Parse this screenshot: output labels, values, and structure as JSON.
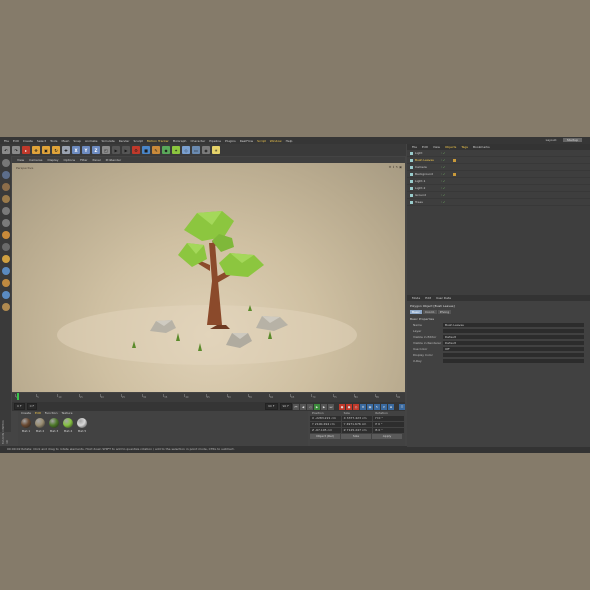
{
  "menubar": {
    "items": [
      "File",
      "Edit",
      "Create",
      "Select",
      "Tools",
      "Mesh",
      "Snap",
      "Animate",
      "Simulate",
      "Render",
      "Sculpt",
      "Motion Tracker",
      "MoGraph",
      "Character",
      "Pipeline",
      "Plugins",
      "RealFlow",
      "Script",
      "Window",
      "Help"
    ],
    "highlighted": [
      "Motion Tracker",
      "Script",
      "Window"
    ],
    "layout_label": "Layout:",
    "layout_value": "Startup"
  },
  "viewport": {
    "menu": [
      "View",
      "Cameras",
      "Display",
      "Options",
      "Filter",
      "Panel",
      "ProRender"
    ],
    "label": "Perspective"
  },
  "timeline": {
    "ticks": [
      "0",
      "5",
      "10",
      "15",
      "20",
      "25",
      "30",
      "35",
      "40",
      "45",
      "50",
      "55",
      "60",
      "65",
      "70",
      "75",
      "80",
      "85",
      "90"
    ],
    "frame_end": "0 F"
  },
  "transport": {
    "start_frame": "0 F",
    "current_frame": "0 F",
    "end_frame": "90 F",
    "end_frame2": "90 F"
  },
  "material_manager": {
    "menu": [
      "Create",
      "Edit",
      "Function",
      "Texture"
    ],
    "highlighted": "Edit",
    "materials": [
      {
        "label": "Mat.1",
        "color": "#6a4a32"
      },
      {
        "label": "Mat.2",
        "color": "#9a8e72"
      },
      {
        "label": "Mat.3",
        "color": "#4e7a2a"
      },
      {
        "label": "Mat.4",
        "color": "#86c242"
      },
      {
        "label": "Mat.5",
        "color": "#d8d8d8"
      }
    ]
  },
  "coordinates": {
    "headers": [
      "Position",
      "Size",
      "Rotation"
    ],
    "rows": [
      [
        "X  -2283.221 cm",
        "X  3377.423 cm",
        "H  0 °"
      ],
      [
        "Y  2100.294 cm",
        "Y  4971.676 cm",
        "P  0 °"
      ],
      [
        "Z  -67.105 cm",
        "Z  7125.247 cm",
        "B  0 °"
      ]
    ],
    "buttons": [
      "Object (Rel)",
      "Size",
      "Apply"
    ]
  },
  "brand": "MAXON CINEMA 4D",
  "statusbar": "00:00:02    Rotate: Click and drag to rotate elements. Hold down SHIFT to add to quantize rotation / add to the selection in point mode, CTRL to subtract.",
  "object_manager": {
    "tabs": [
      "File",
      "Edit",
      "View",
      "Objects",
      "Tags",
      "Bookmarks"
    ],
    "highlighted": [
      "Objects",
      "Tags"
    ],
    "objects": [
      {
        "name": "Light",
        "selected": false
      },
      {
        "name": "Bush Leaves",
        "selected": true
      },
      {
        "name": "Camera",
        "selected": false
      },
      {
        "name": "Background",
        "selected": false
      },
      {
        "name": "Light.1",
        "selected": false
      },
      {
        "name": "Light.2",
        "selected": false
      },
      {
        "name": "Ground",
        "selected": false
      },
      {
        "name": "Trees",
        "selected": false
      }
    ]
  },
  "attribute_manager": {
    "tabs": [
      "Mode",
      "Edit",
      "User Data"
    ],
    "title": "Polygon Object [Bush Leaves]",
    "subtabs": [
      "Basic",
      "Coord.",
      "Phong"
    ],
    "active_subtab": "Basic",
    "section": "Basic Properties",
    "fields": [
      {
        "name": "Name",
        "value": "Bush Leaves"
      },
      {
        "name": "Layer",
        "value": ""
      },
      {
        "name": "Visible in Editor",
        "value": "Default"
      },
      {
        "name": "Visible in Renderer",
        "value": "Default"
      },
      {
        "name": "Use Color",
        "value": "Off"
      },
      {
        "name": "Display Color",
        "value": ""
      },
      {
        "name": "X-Ray",
        "value": ""
      }
    ]
  },
  "colors": {
    "accent": "#f2c84b",
    "foliage": "#8cc63f",
    "trunk": "#8b4a2b",
    "ground": "#d8c9ad"
  }
}
